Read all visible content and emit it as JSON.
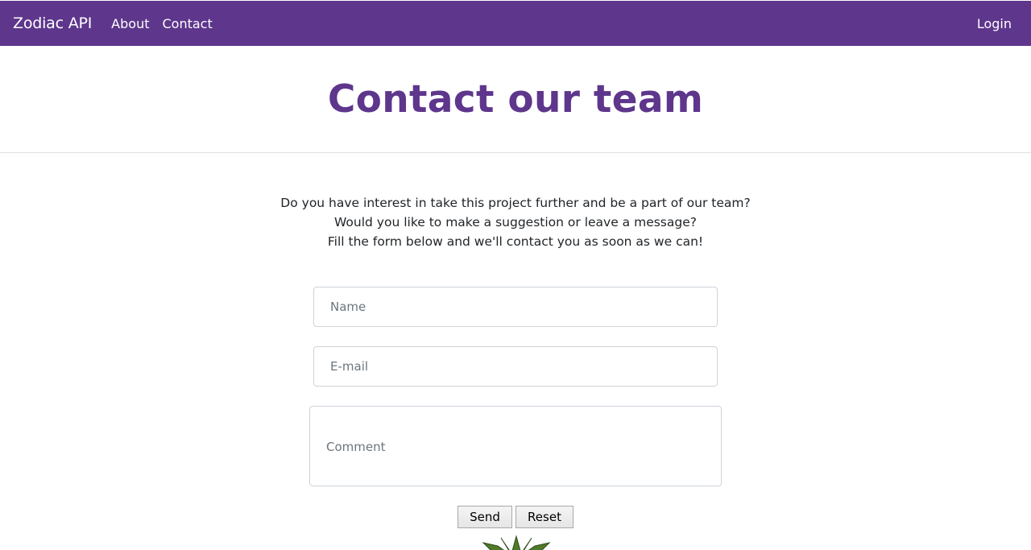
{
  "navbar": {
    "brand": "Zodiac API",
    "links": [
      "About",
      "Contact"
    ],
    "login": "Login",
    "color": "#5e368c"
  },
  "header": {
    "title": "Contact our team"
  },
  "intro": {
    "lines": [
      "Do you have interest in take this project further and be a part of our team?",
      "Would you like to make a suggestion or leave a message?",
      "Fill the form below and we'll contact you as soon as we can!"
    ]
  },
  "form": {
    "name_placeholder": "Name",
    "email_placeholder": "E-mail",
    "comment_placeholder": "Comment",
    "send_label": "Send",
    "reset_label": "Reset"
  },
  "decoration": {
    "icon": "cannabis-leaf-icon",
    "color": "#4f7a2a"
  }
}
